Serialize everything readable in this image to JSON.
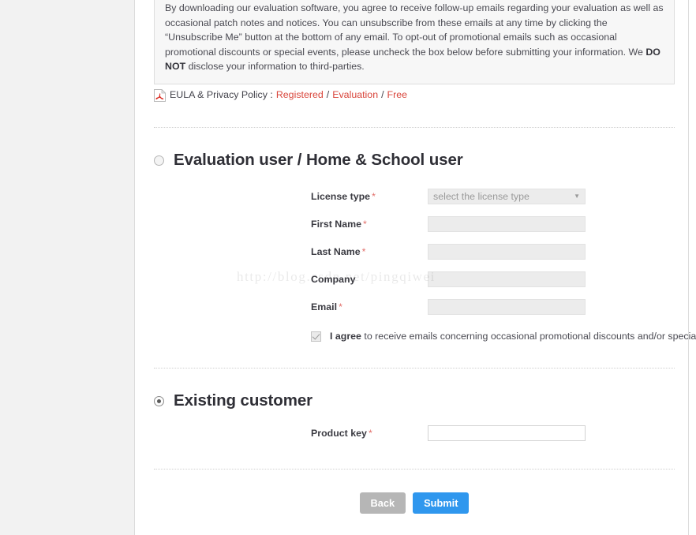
{
  "notice": {
    "paragraph_html": "By downloading our evaluation software, you agree to receive follow-up emails regarding your evaluation as well as occasional patch notes and notices. You can unsubscribe from these emails at any time by clicking the “Unsubscribe Me” button at the bottom of any email. To opt-out of promotional emails such as occasional promotional discounts or special events, please uncheck the box below before submitting your information. We <b>DO NOT</b> disclose your information to third-parties."
  },
  "eula": {
    "icon": "pdf-icon",
    "label": "EULA & Privacy Policy :",
    "links": [
      "Registered",
      "Evaluation",
      "Free"
    ],
    "separator": "/",
    "link_color": "#d9453b"
  },
  "evaluation_section": {
    "radio_selected": false,
    "title": "Evaluation user / Home & School user",
    "fields": {
      "license_type": {
        "label": "License type",
        "required": "*",
        "placeholder": "select the license type",
        "value": "",
        "arrow": "▼",
        "disabled": true
      },
      "first_name": {
        "label": "First Name",
        "required": "*",
        "value": "",
        "placeholder": "",
        "disabled": true
      },
      "last_name": {
        "label": "Last Name",
        "required": "*",
        "value": "",
        "placeholder": "",
        "disabled": true
      },
      "company": {
        "label": "Company",
        "required": "",
        "value": "",
        "placeholder": "",
        "disabled": true
      },
      "email": {
        "label": "Email",
        "required": "*",
        "value": "",
        "placeholder": "",
        "disabled": true
      }
    },
    "agree": {
      "checked": true,
      "bold_part": "I agree",
      "rest": " to receive emails concerning occasional promotional discounts and/or special events."
    }
  },
  "existing_section": {
    "radio_selected": true,
    "title": "Existing customer",
    "fields": {
      "product_key": {
        "label": "Product key",
        "required": "*",
        "value": "",
        "placeholder": "",
        "disabled": false
      }
    }
  },
  "buttons": {
    "back": "Back",
    "submit": "Submit",
    "back_color": "#b6b6b6",
    "submit_color": "#2f97ee"
  },
  "watermark": {
    "text": "http://blog.csdn.net/pingqiwei"
  }
}
